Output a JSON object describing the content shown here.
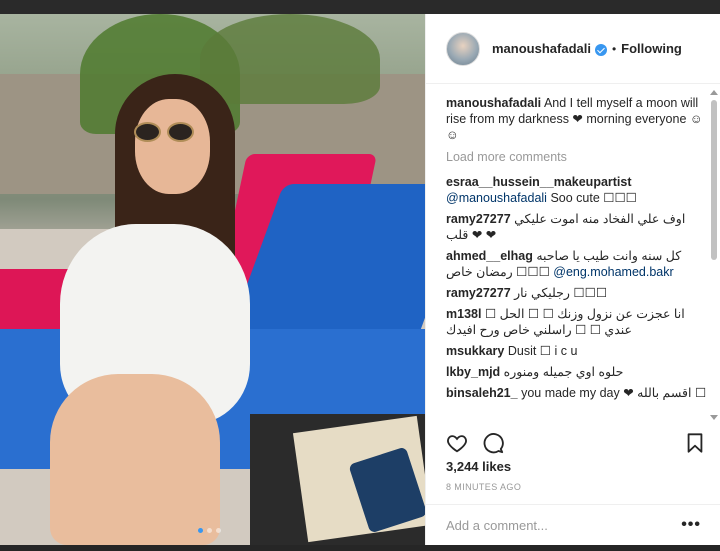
{
  "header": {
    "username": "manoushafadali",
    "separator": "•",
    "follow_status": "Following"
  },
  "caption": {
    "username": "manoushafadali",
    "text": "And I tell myself a moon will rise from my darkness ❤ morning everyone ☺☺"
  },
  "load_more": "Load more comments",
  "comments": [
    {
      "user": "esraa__hussein__makeupartist",
      "mention": "@manoushafadali",
      "text": "Soo cute ☐☐☐",
      "rtl": false
    },
    {
      "user": "ramy27277",
      "text": "اوف علي الفخاد منه اموت عليكي قلب ❤ ❤",
      "rtl": true
    },
    {
      "user": "ahmed__elhag",
      "text": "كل سنه وانت طيب يا صاحبه رمضان خاص ☐☐☐",
      "mention": "@eng.mohamed.bakr",
      "rtl": true
    },
    {
      "user": "ramy27277",
      "text": "رجليكي نار ☐☐☐",
      "rtl": true
    },
    {
      "user": "m138l",
      "text": "☐ انا عجزت عن نزول وزنك ☐ ☐ الحل عندي ☐ ☐ راسلني خاص ورح افيدك",
      "rtl": true
    },
    {
      "user": "msukkary",
      "text": "Dusit ☐ i c u",
      "rtl": false
    },
    {
      "user": "lkby_mjd",
      "text": "حلوه اوي جميله ومنوره",
      "rtl": false
    },
    {
      "user": "binsaleh21_",
      "text": "you made my day ❤ اقسم بالله ☐",
      "rtl": false
    }
  ],
  "likes": "3,244 likes",
  "timestamp": "8 MINUTES AGO",
  "add_comment_placeholder": "Add a comment...",
  "more_options": "•••",
  "colors": {
    "accent": "#3897f0",
    "text": "#262626",
    "muted": "#999999",
    "border": "#efefef"
  },
  "icons": [
    "heart-icon",
    "comment-icon",
    "bookmark-icon",
    "verified-icon"
  ]
}
